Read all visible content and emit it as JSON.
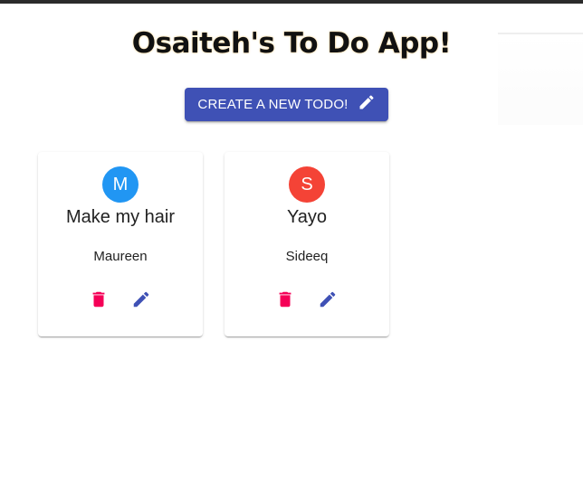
{
  "app": {
    "title": "Osaiteh's To Do App!"
  },
  "create_button": {
    "label": "CREATE A NEW TODO!",
    "icon": "pencil-icon",
    "color": "#3f51b5"
  },
  "todos": [
    {
      "avatar_letter": "M",
      "avatar_color": "#2196f3",
      "title": "Make my hair",
      "owner": "Maureen",
      "delete_icon": "trash-icon",
      "delete_color": "#f50057",
      "edit_icon": "pencil-icon",
      "edit_color": "#3f51b5"
    },
    {
      "avatar_letter": "S",
      "avatar_color": "#f44336",
      "title": "Yayo",
      "owner": "Sideeq",
      "delete_icon": "trash-icon",
      "delete_color": "#f50057",
      "edit_icon": "pencil-icon",
      "edit_color": "#3f51b5"
    }
  ]
}
